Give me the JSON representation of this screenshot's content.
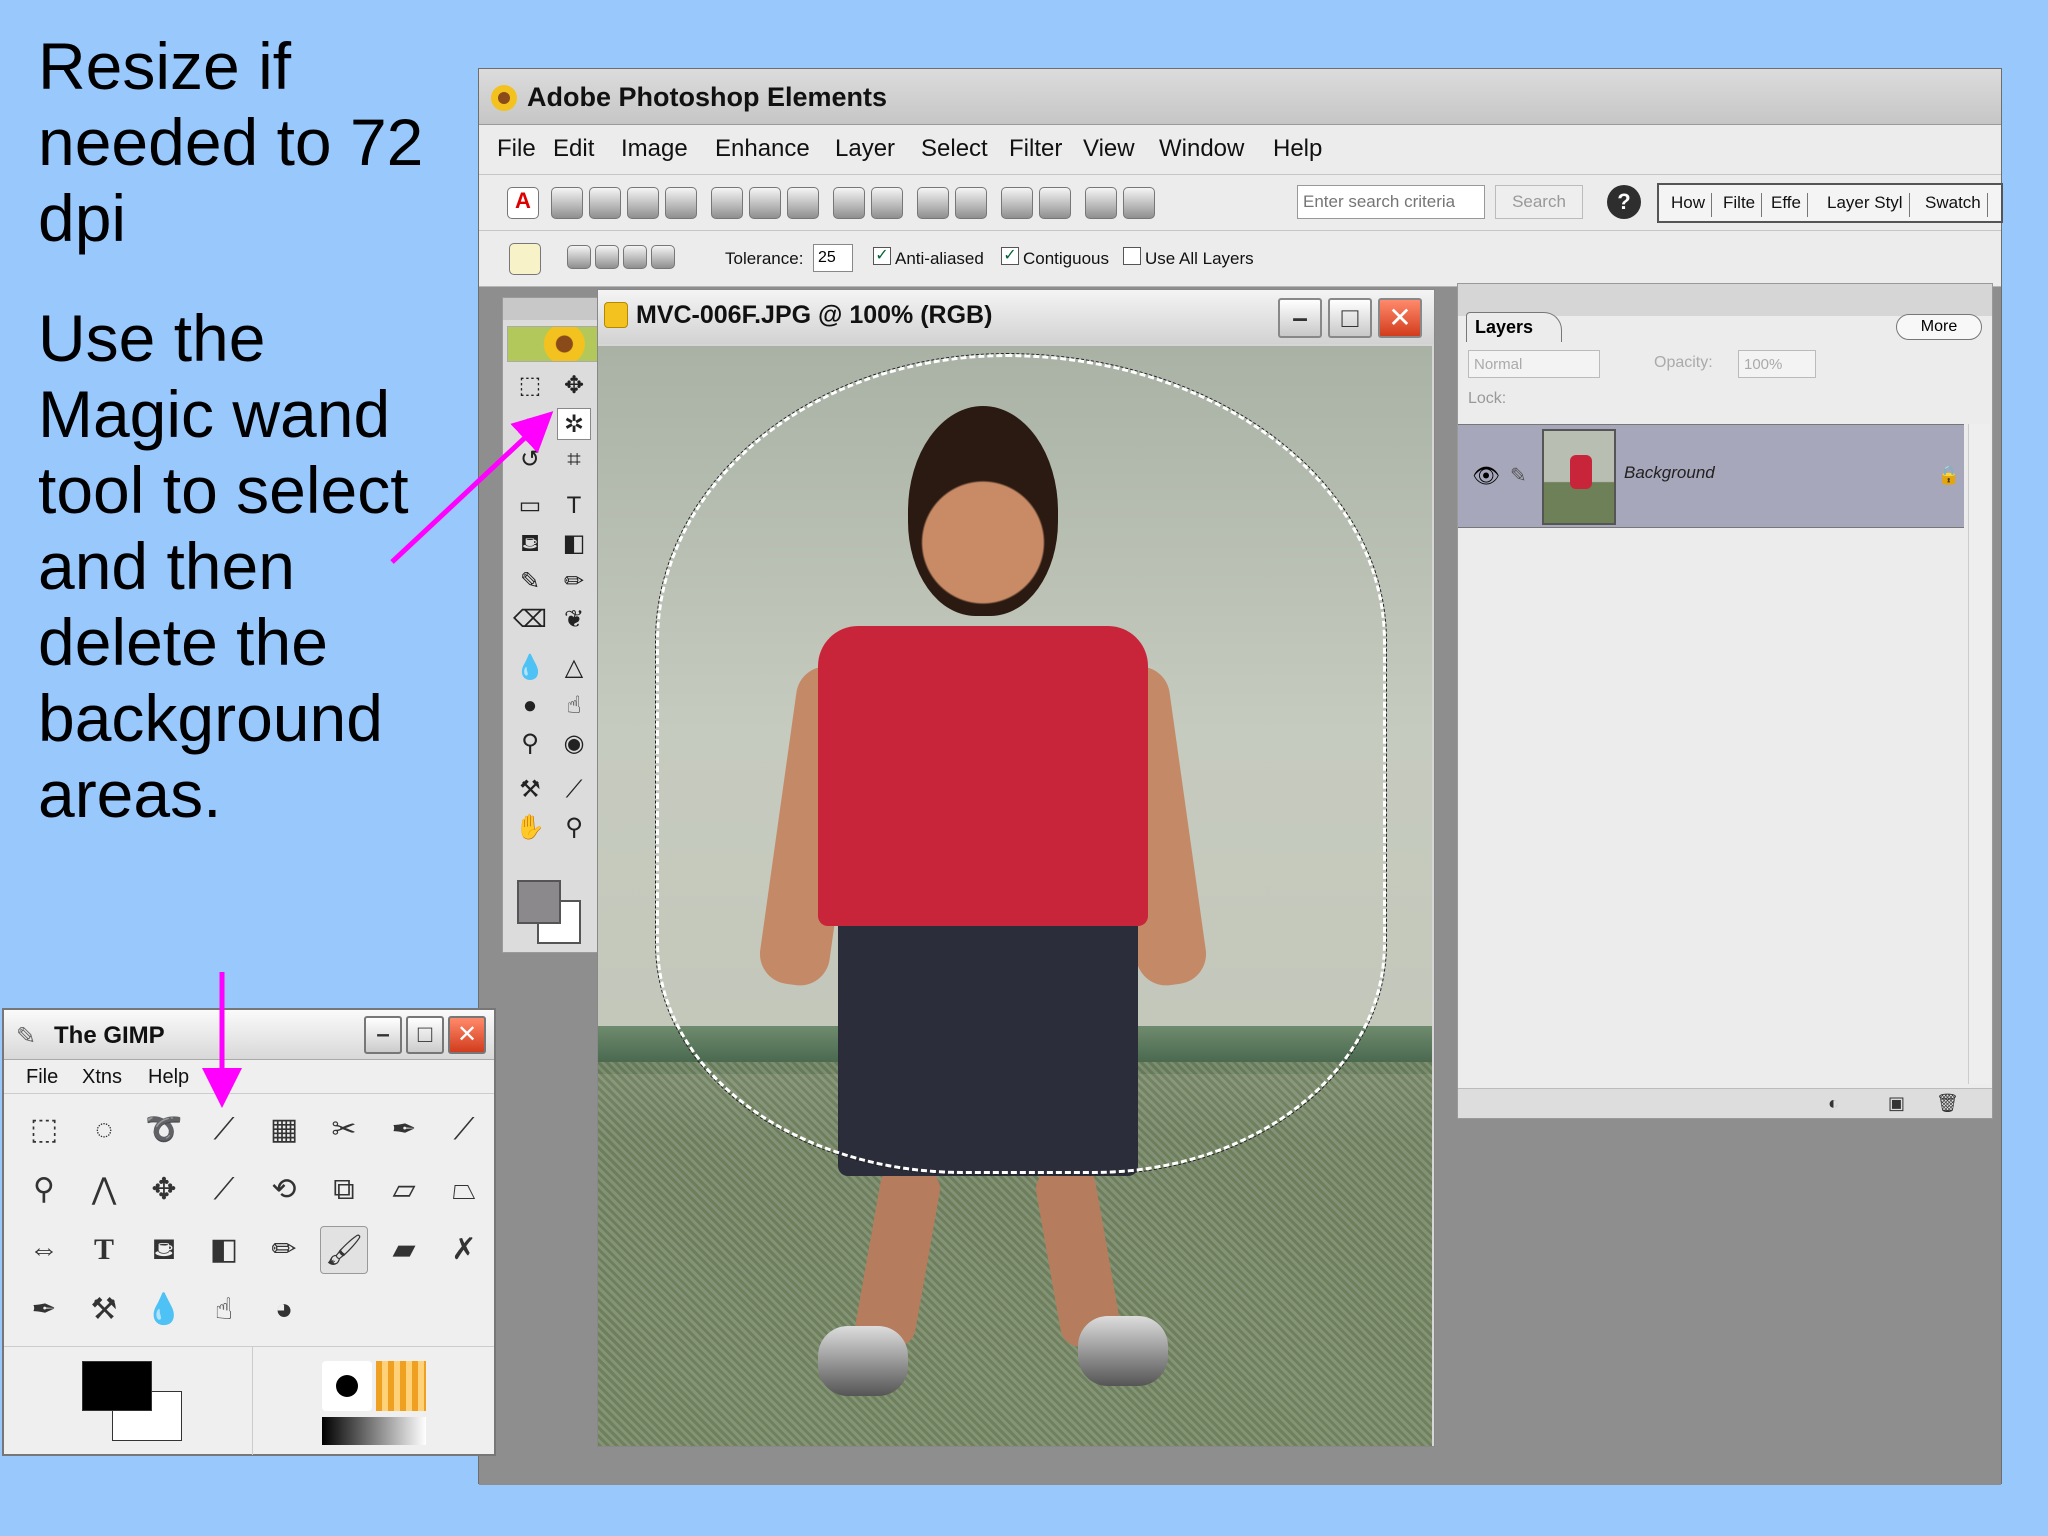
{
  "slide": {
    "text_1": "Resize if needed to 72 dpi",
    "text_2": "Use the Magic wand tool to select and then delete the background areas."
  },
  "photoshop": {
    "title": "Adobe Photoshop Elements",
    "menu": [
      "File",
      "Edit",
      "Image",
      "Enhance",
      "Layer",
      "Select",
      "Filter",
      "View",
      "Window",
      "Help"
    ],
    "search_placeholder": "Enter search criteria",
    "search_button": "Search",
    "help_button": "?",
    "palette_tabs": [
      "How",
      "Filte",
      "Effe",
      "Layer Styl",
      "Swatch"
    ],
    "options": {
      "tolerance_label": "Tolerance:",
      "tolerance_value": "25",
      "anti_aliased_label": "Anti-aliased",
      "anti_aliased_checked": true,
      "contiguous_label": "Contiguous",
      "contiguous_checked": true,
      "use_all_layers_label": "Use All Layers",
      "use_all_layers_checked": false
    },
    "document": {
      "title": "MVC-006F.JPG @ 100% (RGB)"
    },
    "layers": {
      "tab_label": "Layers",
      "more_label": "More",
      "blend_mode": "Normal",
      "opacity_label": "Opacity:",
      "opacity_value": "100%",
      "lock_label": "Lock:",
      "layer_name": "Background"
    }
  },
  "gimp": {
    "title": "The GIMP",
    "menu": [
      "File",
      "Xtns",
      "Help"
    ]
  },
  "colors": {
    "slide_background": "#99c8fd",
    "arrow": "#ff00ff",
    "photoshop_foreground": "#8b898b",
    "gimp_foreground": "#000000"
  }
}
